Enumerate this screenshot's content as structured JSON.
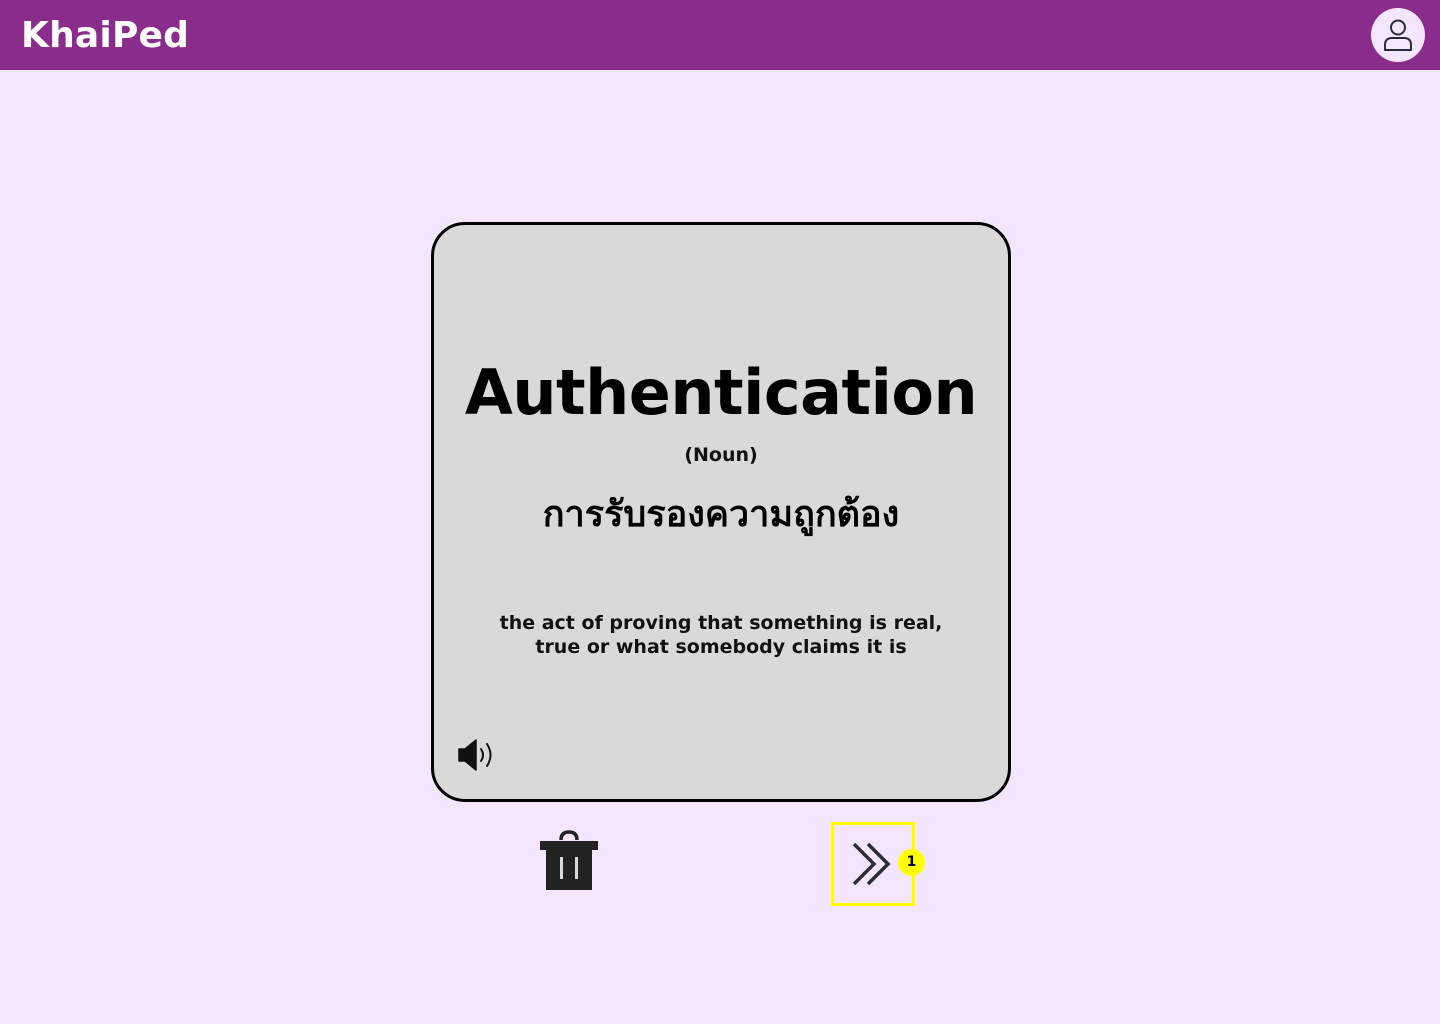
{
  "header": {
    "brand": "KhaiPed",
    "avatar_icon": "user-icon",
    "background": "#8A2C8C"
  },
  "card": {
    "term": "Authentication",
    "part_of_speech": "(Noun)",
    "translation": "การรับรองความถูกต้อง",
    "definition": "the act of proving that something is real, true or what somebody claims it is",
    "audio_icon": "speaker-icon"
  },
  "actions": {
    "delete_icon": "trash-icon",
    "next_icon": "double-chevron-right-icon",
    "next_badge": "1",
    "highlight_color": "#FFFF00"
  },
  "page": {
    "background": "#F5E6FF"
  }
}
